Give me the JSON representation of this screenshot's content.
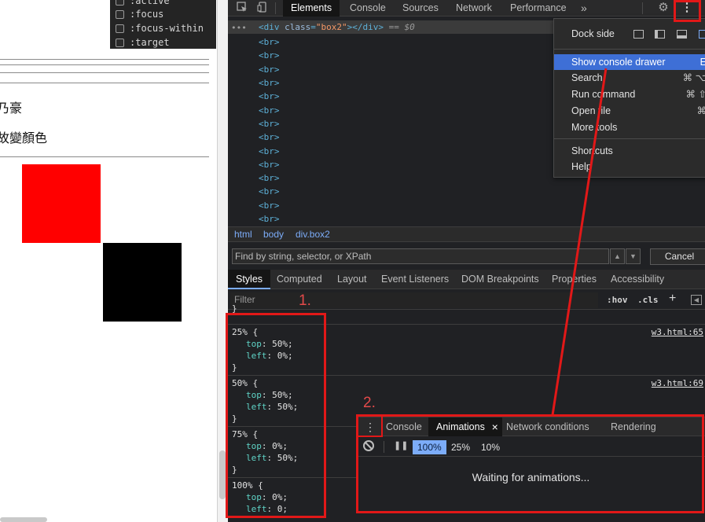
{
  "page": {
    "pseudo_items": [
      ":active",
      ":focus",
      ":focus-within",
      ":target"
    ],
    "text_line_1": "乃豪",
    "text_line_2": "故變顏色"
  },
  "devtools": {
    "tabs": [
      "Elements",
      "Console",
      "Sources",
      "Network",
      "Performance"
    ],
    "more_tabs_icon": "»",
    "elements": {
      "selected_tag_open": "<div ",
      "selected_attr": "class",
      "selected_eq": "=",
      "selected_val": "\"box2\"",
      "selected_tag_close": "></div>",
      "selected_suffix": " == $0",
      "br_tag": "<br>",
      "ellipsis": "•••"
    },
    "breadcrumbs": [
      "html",
      "body",
      "div.box2"
    ],
    "search_placeholder": "Find by string, selector, or XPath",
    "cancel_label": "Cancel",
    "styles_tabs": [
      "Styles",
      "Computed",
      "Layout",
      "Event Listeners",
      "DOM Breakpoints",
      "Properties",
      "Accessibility"
    ],
    "filter_placeholder": "Filter",
    "hov_label": ":hov",
    "cls_label": ".cls",
    "plus_label": "+",
    "rules": [
      {
        "selector": "25% {",
        "source": "w3.html:65",
        "props": [
          {
            "name": "top",
            "value": "50%;"
          },
          {
            "name": "left",
            "value": "0%;"
          }
        ]
      },
      {
        "selector": "50% {",
        "source": "w3.html:69",
        "props": [
          {
            "name": "top",
            "value": "50%;"
          },
          {
            "name": "left",
            "value": "50%;"
          }
        ]
      },
      {
        "selector": "75% {",
        "source": "",
        "props": [
          {
            "name": "top",
            "value": "0%;"
          },
          {
            "name": "left",
            "value": "50%;"
          }
        ]
      },
      {
        "selector": "100% {",
        "source": "",
        "props": [
          {
            "name": "top",
            "value": "0%;"
          },
          {
            "name": "left",
            "value": "0;"
          }
        ]
      }
    ],
    "rule_close": "}",
    "drawer": {
      "tabs": [
        "Console",
        "Animations",
        "Network conditions",
        "Rendering"
      ],
      "close_icon": "×",
      "speeds": [
        "100%",
        "25%",
        "10%"
      ],
      "waiting_text": "Waiting for animations..."
    },
    "menu": {
      "dock_side_label": "Dock side",
      "items": [
        {
          "label": "Show console drawer",
          "shortcut": "E"
        },
        {
          "label": "Search",
          "shortcut": "⌘ ⌥"
        },
        {
          "label": "Run command",
          "shortcut": "⌘ ⇧"
        },
        {
          "label": "Open file",
          "shortcut": "⌘"
        },
        {
          "label": "More tools",
          "shortcut": ""
        },
        {
          "label": "Shortcuts",
          "shortcut": ""
        },
        {
          "label": "Help",
          "shortcut": ""
        }
      ]
    }
  },
  "annotations": {
    "label_1": "1.",
    "label_2": "2."
  },
  "colors": {
    "annotation_red": "#e11818",
    "menu_highlight": "#3e6fd6",
    "red_box": "#ff0000",
    "black_box": "#000000"
  }
}
